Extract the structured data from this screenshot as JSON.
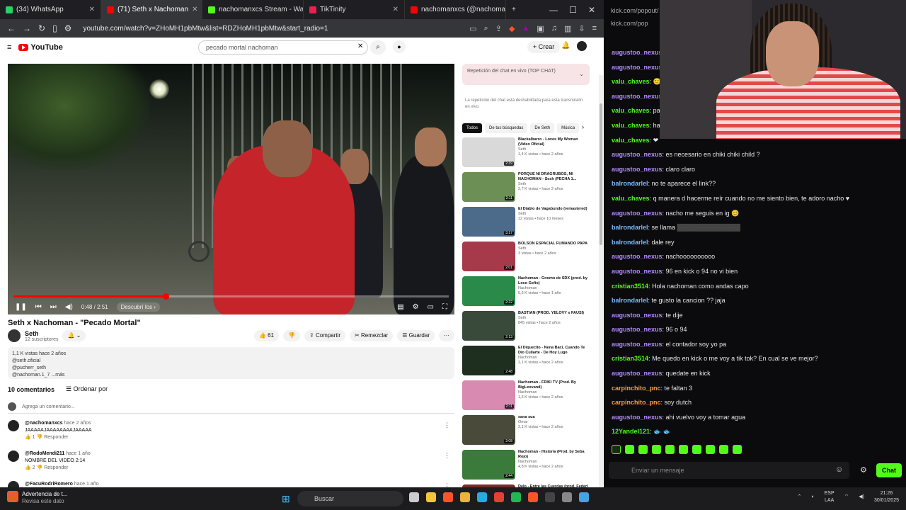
{
  "browser": {
    "tabs": [
      {
        "label": "(34) WhatsApp",
        "color": "#25d366",
        "active": false
      },
      {
        "label": "(71) Seth x Nachoman",
        "color": "#ff0000",
        "active": true
      },
      {
        "label": "nachomanxcs Stream - Wa",
        "color": "#53fc18",
        "active": false
      },
      {
        "label": "TikTinity",
        "color": "#ee1d52",
        "active": false
      },
      {
        "label": "nachomanxcs (@nachomanx",
        "color": "#ff0000",
        "active": false
      }
    ],
    "new_tab": "+",
    "url": "youtube.com/watch?v=ZHoMH1pbMtw&list=RDZHoMH1pbMtw&start_radio=1"
  },
  "youtube": {
    "logo_text": "YouTube",
    "search_value": "pecado mortal nachoman",
    "create_label": "Crear",
    "video": {
      "title": "Seth x Nachoman - \"Pecado Mortal\"",
      "time": "0:48 / 2:51",
      "chapter": "Descubrí los ›",
      "progress": 0.35
    },
    "channel": {
      "name": "Seth",
      "subs": "12 suscriptores"
    },
    "actions": {
      "likes": "61",
      "share": "Compartir",
      "remix": "Remezclar",
      "save": "Guardar"
    },
    "description": [
      "1,1 K vistas hace 2 años",
      "@seth.oficial",
      "@pucherr_seth",
      "@nachoman.1_7 ...más"
    ],
    "comments": {
      "count": "10 comentarios",
      "sort": "Ordenar por",
      "add_placeholder": "Agrega un comentario...",
      "items": [
        {
          "user": "@nachomanxcs",
          "meta": "hace 2 años",
          "text": "JAAAAAJAAAAAAAAJAAAAA",
          "likes": "1",
          "reply": "Responder"
        },
        {
          "user": "@RodoMendi211",
          "meta": "hace 1 año",
          "text": "NOMBRE DEL VIDEO 2:14",
          "likes": "2",
          "reply": "Responder"
        },
        {
          "user": "@FacuRodriRomero",
          "meta": "hace 1 año",
          "text": "",
          "likes": "",
          "reply": ""
        }
      ]
    },
    "chat_replay": {
      "title": "Repetición del chat en vivo (TOP CHAT)",
      "note": "La repetición del chat está deshabilitada para esta transmisión en vivo."
    },
    "chips": [
      "Todos",
      "De tus búsquedas",
      "De Seth",
      "Música"
    ],
    "recommendations": [
      {
        "title": "Blackalbarro - Loves My Woman (Video Oficial)",
        "channel": "Seth",
        "views": "1,4 K vistas • hace 2 años",
        "dur": "2:39",
        "color": "#d9d9d9"
      },
      {
        "title": "PORQUE NI DRAGRUBOS, MI NACHOMAN - Sesh (PECHA 1...",
        "channel": "Seth",
        "views": "2,7 K vistas • hace 2 años",
        "dur": "2:11",
        "color": "#6b8f55"
      },
      {
        "title": "El Diablo de Vagabundo (remastered)",
        "channel": "Seth",
        "views": "12 vistas • hace 10 meses",
        "dur": "3:17",
        "color": "#4c6a8a"
      },
      {
        "title": "BOLSON ESPACIAL FUMANDO PAPA",
        "channel": "Seth",
        "views": "3 vistas • hace 2 años",
        "dur": "2:01",
        "color": "#a63a4a"
      },
      {
        "title": "Nachoman - Gnomo de SDX (prod. by Loco Geño)",
        "channel": "Nachoman",
        "views": "5,6 K vistas • hace 1 año",
        "dur": "2:22",
        "color": "#2a8a4a"
      },
      {
        "title": "BASTIAN (PROD. YELOVY x FAUSI)",
        "channel": "Seth",
        "views": "845 vistas • hace 2 años",
        "dur": "2:13",
        "color": "#3a4a3a"
      },
      {
        "title": "El Diquecito - Nena Baci, Cuando Te Dio Culiarte - De Hoy Lugo",
        "channel": "Nachoman",
        "views": "2,1 K vistas • hace 2 años",
        "dur": "2:48",
        "color": "#1f2f1f"
      },
      {
        "title": "Nachoman - FRIKI TV (Prod. By BigLeovand)",
        "channel": "Nachoman",
        "views": "1,5 K vistas • hace 2 años",
        "dur": "2:11",
        "color": "#d98ab0"
      },
      {
        "title": "sana sua",
        "channel": "Omar",
        "views": "2,1 K vistas • hace 2 años",
        "dur": "2:08",
        "color": "#4a4a3a"
      },
      {
        "title": "Nachoman - Historia (Prod. by Seba Rojo)",
        "channel": "Nachoman",
        "views": "4,8 K vistas • hace 2 años",
        "dur": "2:44",
        "color": "#3a7a3a"
      },
      {
        "title": "Delo - Entre las Cuerdas (prod. Feder)",
        "channel": "Delo",
        "views": "",
        "dur": "",
        "color": "#7a2a2a"
      }
    ]
  },
  "kick": {
    "url_text": [
      "kick.com/popout/",
      "kick.com/pop"
    ],
    "messages": [
      {
        "user": "augustoo_nexus",
        "color": "#b48cff",
        "text": ""
      },
      {
        "user": "augustoo_nexus",
        "color": "#b48cff",
        "text": ""
      },
      {
        "user": "valu_chaves",
        "color": "#53fc18",
        "text": "🙂"
      },
      {
        "user": "augustoo_nexus",
        "color": "#b48cff",
        "text": ""
      },
      {
        "user": "valu_chaves",
        "color": "#53fc18",
        "text": "pa"
      },
      {
        "user": "valu_chaves",
        "color": "#53fc18",
        "text": "ha"
      },
      {
        "user": "valu_chaves",
        "color": "#53fc18",
        "text": "❤"
      },
      {
        "user": "augustoo_nexus",
        "color": "#b48cff",
        "text": "es necesario en chiki chiki child ?"
      },
      {
        "user": "augustoo_nexus",
        "color": "#b48cff",
        "text": "claro claro"
      },
      {
        "user": "balrondarlel",
        "color": "#7ab8ff",
        "text": "no te aparece el link??"
      },
      {
        "user": "valu_chaves",
        "color": "#53fc18",
        "text": "q manera d hacerme reír cuando no me siento bien, te adoro nacho ♥"
      },
      {
        "user": "augustoo_nexus",
        "color": "#b48cff",
        "text": "nacho me seguis en ig 😊"
      },
      {
        "user": "balrondarlel",
        "color": "#7ab8ff",
        "text": "se llama",
        "censored": "██████████████"
      },
      {
        "user": "balrondarlel",
        "color": "#7ab8ff",
        "text": "dale rey"
      },
      {
        "user": "augustoo_nexus",
        "color": "#b48cff",
        "text": "nachoooooooooo"
      },
      {
        "user": "augustoo_nexus",
        "color": "#b48cff",
        "text": "96 en kick o 94 no vi bien"
      },
      {
        "user": "cristian3514",
        "color": "#53fc18",
        "text": "Hola nachoman como andas capo"
      },
      {
        "user": "balrondarlel",
        "color": "#7ab8ff",
        "text": "te gusto la cancion ?? jaja"
      },
      {
        "user": "augustoo_nexus",
        "color": "#b48cff",
        "text": "te dije"
      },
      {
        "user": "augustoo_nexus",
        "color": "#b48cff",
        "text": "96 o 94"
      },
      {
        "user": "augustoo_nexus",
        "color": "#b48cff",
        "text": "el contador soy yo pa"
      },
      {
        "user": "cristian3514",
        "color": "#53fc18",
        "text": "Me quedo en kick o me voy a tik tok? En cual se ve mejor?"
      },
      {
        "user": "augustoo_nexus",
        "color": "#b48cff",
        "text": "quedate en kick"
      },
      {
        "user": "carpinchito_pnc",
        "color": "#ff9a3c",
        "text": "te faltan 3"
      },
      {
        "user": "carpinchito_pnc",
        "color": "#ff9a3c",
        "text": "soy dutch"
      },
      {
        "user": "augustoo_nexus",
        "color": "#b48cff",
        "text": "ahi vuelvo voy a tomar agua"
      },
      {
        "user": "12Yandel121",
        "color": "#53fc18",
        "text": "🐟 🐟"
      }
    ],
    "input_placeholder": "Enviar un mensaje",
    "send_label": "Chat"
  },
  "taskbar": {
    "warning_title": "Advertencia de t...",
    "warning_sub": "Revisa este dato",
    "search": "Buscar",
    "lang_top": "ESP",
    "lang_bottom": "LAA",
    "time": "21:26",
    "date": "30/01/2025"
  }
}
